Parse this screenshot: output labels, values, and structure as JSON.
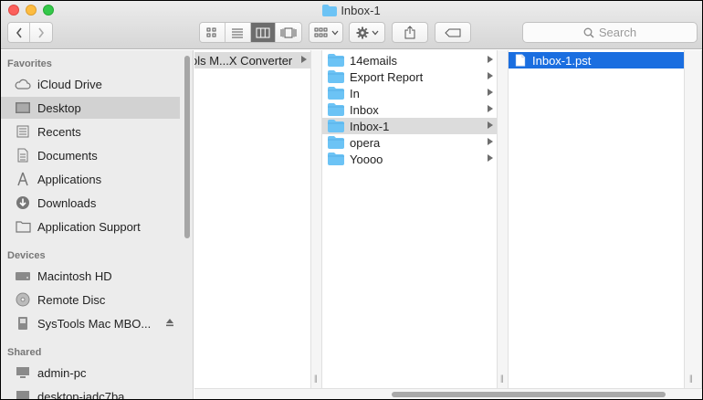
{
  "window": {
    "title": "Inbox-1"
  },
  "toolbar": {
    "back_icon": "chevron-left",
    "forward_icon": "chevron-right",
    "view_modes": [
      "icon-view",
      "list-view",
      "column-view",
      "cover-flow-view"
    ],
    "active_view": "column-view",
    "search_placeholder": "Search"
  },
  "sidebar": {
    "favorites_heading": "Favorites",
    "favorites": [
      {
        "label": "iCloud Drive",
        "icon": "cloud-icon"
      },
      {
        "label": "Desktop",
        "icon": "desktop-icon",
        "selected": true
      },
      {
        "label": "Recents",
        "icon": "recents-icon"
      },
      {
        "label": "Documents",
        "icon": "documents-icon"
      },
      {
        "label": "Applications",
        "icon": "applications-icon"
      },
      {
        "label": "Downloads",
        "icon": "downloads-icon"
      },
      {
        "label": "Application Support",
        "icon": "folder-icon"
      }
    ],
    "devices_heading": "Devices",
    "devices": [
      {
        "label": "Macintosh HD",
        "icon": "hard-drive-icon"
      },
      {
        "label": "Remote Disc",
        "icon": "disc-icon"
      },
      {
        "label": "SysTools Mac MBO...",
        "icon": "drive-icon",
        "eject": true
      }
    ],
    "shared_heading": "Shared",
    "shared": [
      {
        "label": "admin-pc",
        "icon": "computer-icon"
      },
      {
        "label": "desktop-jadc7ba",
        "icon": "computer-icon"
      }
    ]
  },
  "columns": {
    "col1": [
      {
        "label": "ols M...X Converter",
        "has_children": true
      }
    ],
    "col2": [
      {
        "label": "14emails",
        "has_children": true
      },
      {
        "label": "Export Report",
        "has_children": true
      },
      {
        "label": "In",
        "has_children": true
      },
      {
        "label": "Inbox",
        "has_children": true
      },
      {
        "label": "Inbox-1",
        "has_children": true,
        "selected": true
      },
      {
        "label": "opera",
        "has_children": true
      },
      {
        "label": "Yoooo",
        "has_children": true
      }
    ],
    "col3": [
      {
        "label": "Inbox-1.pst",
        "selected": true
      }
    ]
  },
  "colors": {
    "selection_blue": "#1a6ee0",
    "folder_blue": "#6cc3f5"
  }
}
